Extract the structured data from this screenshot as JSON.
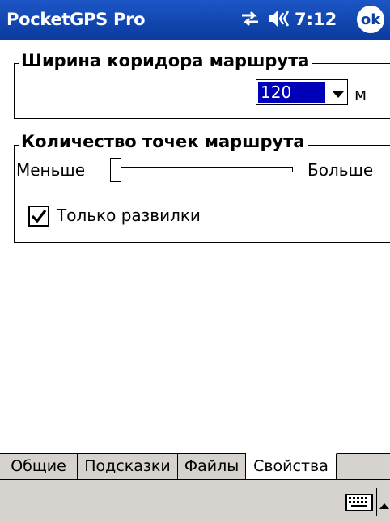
{
  "titlebar": {
    "title": "PocketGPS Pro",
    "time": "7:12",
    "ok_label": "ok"
  },
  "corridor_group": {
    "title": "Ширина коридора маршрута",
    "width_value": "120",
    "unit": "м"
  },
  "points_group": {
    "title": "Количество точек маршрута",
    "min_label": "Меньше",
    "max_label": "Больше",
    "slider_level": 0,
    "checkbox_label": "Только развилки",
    "checkbox_checked": true
  },
  "tabs": [
    {
      "label": "Общие",
      "active": false
    },
    {
      "label": "Подсказки",
      "active": false
    },
    {
      "label": "Файлы",
      "active": false
    },
    {
      "label": "Свойства",
      "active": true
    }
  ],
  "colors": {
    "titlebar": "#0a3fa8",
    "selection": "#0000b8",
    "bar_gray": "#d6d3ce"
  },
  "icons": [
    "connectivity-icon",
    "speaker-icon",
    "keyboard-icon",
    "sip-arrow-up-icon"
  ]
}
